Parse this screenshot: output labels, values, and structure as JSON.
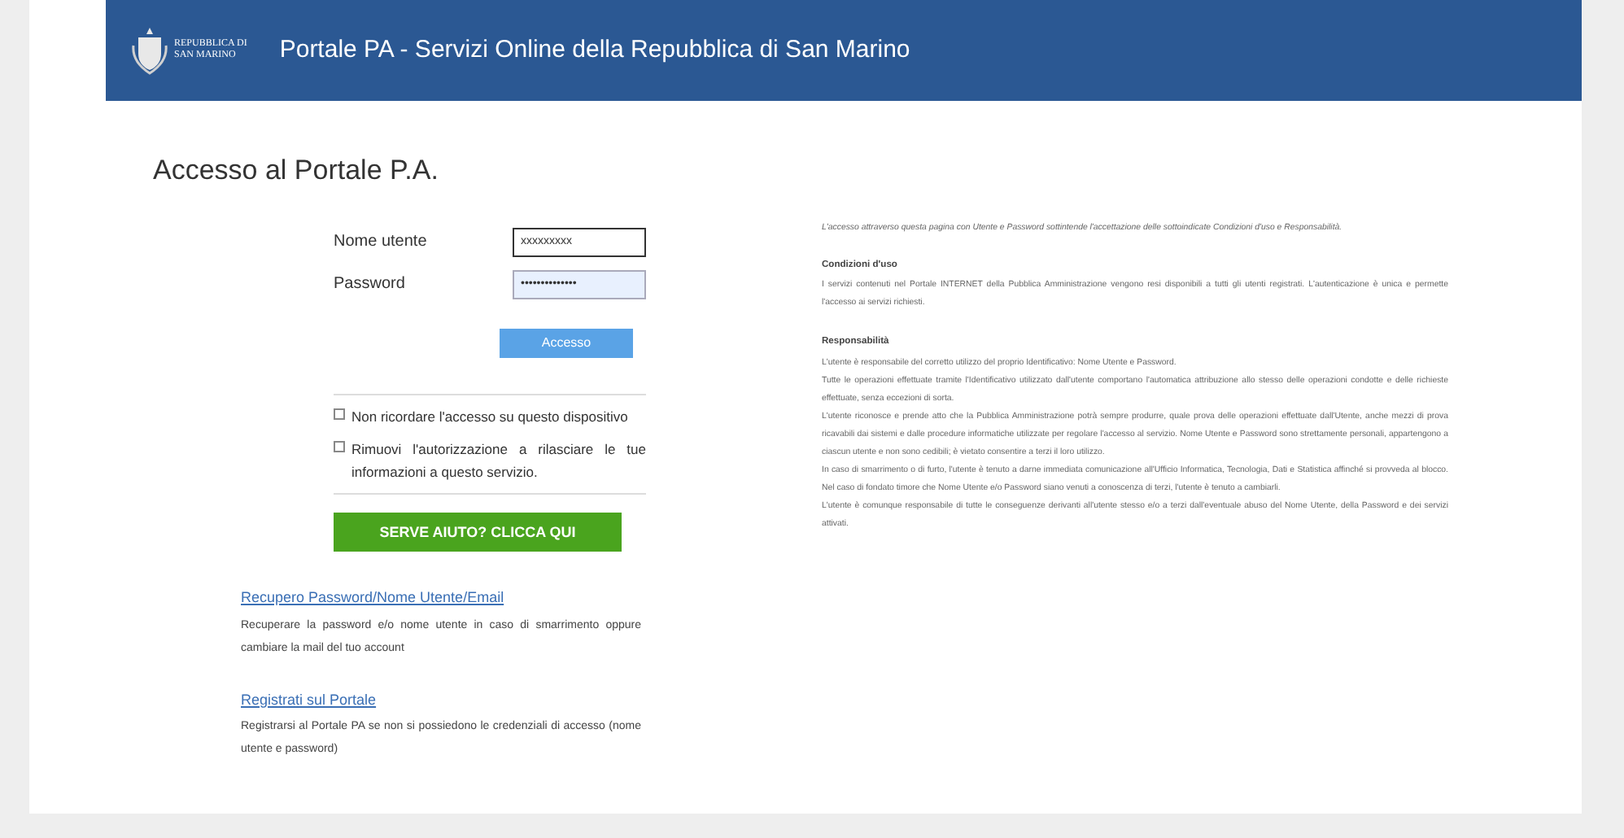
{
  "header": {
    "logo_lines": [
      "REPUBBLICA DI",
      "SAN MARINO"
    ],
    "title": "Portale PA - Servizi Online della Repubblica di San Marino"
  },
  "login": {
    "heading": "Accesso al Portale P.A.",
    "fields": [
      {
        "label": "Nome utente",
        "value": "xxxxxxxxx",
        "focused": true
      },
      {
        "label": "Password",
        "value": "••••••••••••••",
        "focused": false
      }
    ],
    "submit": "Accesso",
    "options": [
      {
        "label": "Non ricordare l'accesso su questo dispositivo",
        "checked": false
      },
      {
        "label": "Rimuovi l'autorizzazione a rilasciare le tue informazioni a questo servizio.",
        "checked": false
      }
    ],
    "help_button": "SERVE AIUTO? CLICCA QUI",
    "links": [
      {
        "link": "Recupero Password/Nome Utente/Email",
        "description": "Recuperare la password e/o nome utente in caso di smarrimento oppure cambiare la mail del tuo account"
      },
      {
        "link": "Registrati sul Portale",
        "description": "Registrarsi al Portale PA se non si possiedono le credenziali di accesso (nome utente e password)"
      }
    ]
  },
  "terms": {
    "intro": "L'accesso attraverso questa pagina con Utente e Password sottintende l'accettazione delle sottoindicate Condizioni d'uso e Responsabilità.",
    "sections": [
      {
        "title": "Condizioni d'uso",
        "paragraphs": [
          "I servizi contenuti nel Portale INTERNET della Pubblica Amministrazione vengono resi disponibili a tutti gli utenti registrati. L'autenticazione è unica e permette l'accesso ai servizi richiesti."
        ]
      },
      {
        "title": "Responsabilità",
        "paragraphs": [
          "L'utente è responsabile del corretto utilizzo del proprio Identificativo: Nome Utente e Password.",
          "Tutte le operazioni effettuate tramite l'Identificativo utilizzato dall'utente comportano l'automatica attribuzione allo stesso delle operazioni condotte e delle richieste effettuate, senza eccezioni di sorta.",
          "L'utente riconosce e prende atto che la Pubblica Amministrazione potrà sempre produrre, quale prova delle operazioni effettuate dall'Utente, anche mezzi di prova ricavabili dai sistemi e dalle procedure informatiche utilizzate per regolare l'accesso al servizio. Nome Utente e Password sono strettamente personali, appartengono a ciascun utente e non sono cedibili; è vietato consentire a terzi il loro utilizzo.",
          "In caso di smarrimento o di furto, l'utente è tenuto a darne immediata comunicazione all'Ufficio Informatica, Tecnologia, Dati e Statistica affinché si provveda al blocco. Nel caso di fondato timore che Nome Utente e/o Password siano venuti a conoscenza di terzi, l'utente è tenuto a cambiarli.",
          "L'utente è comunque responsabile di tutte le conseguenze derivanti all'utente stesso e/o a terzi dall'eventuale abuso del Nome Utente, della Password e dei servizi attivati."
        ]
      }
    ]
  }
}
